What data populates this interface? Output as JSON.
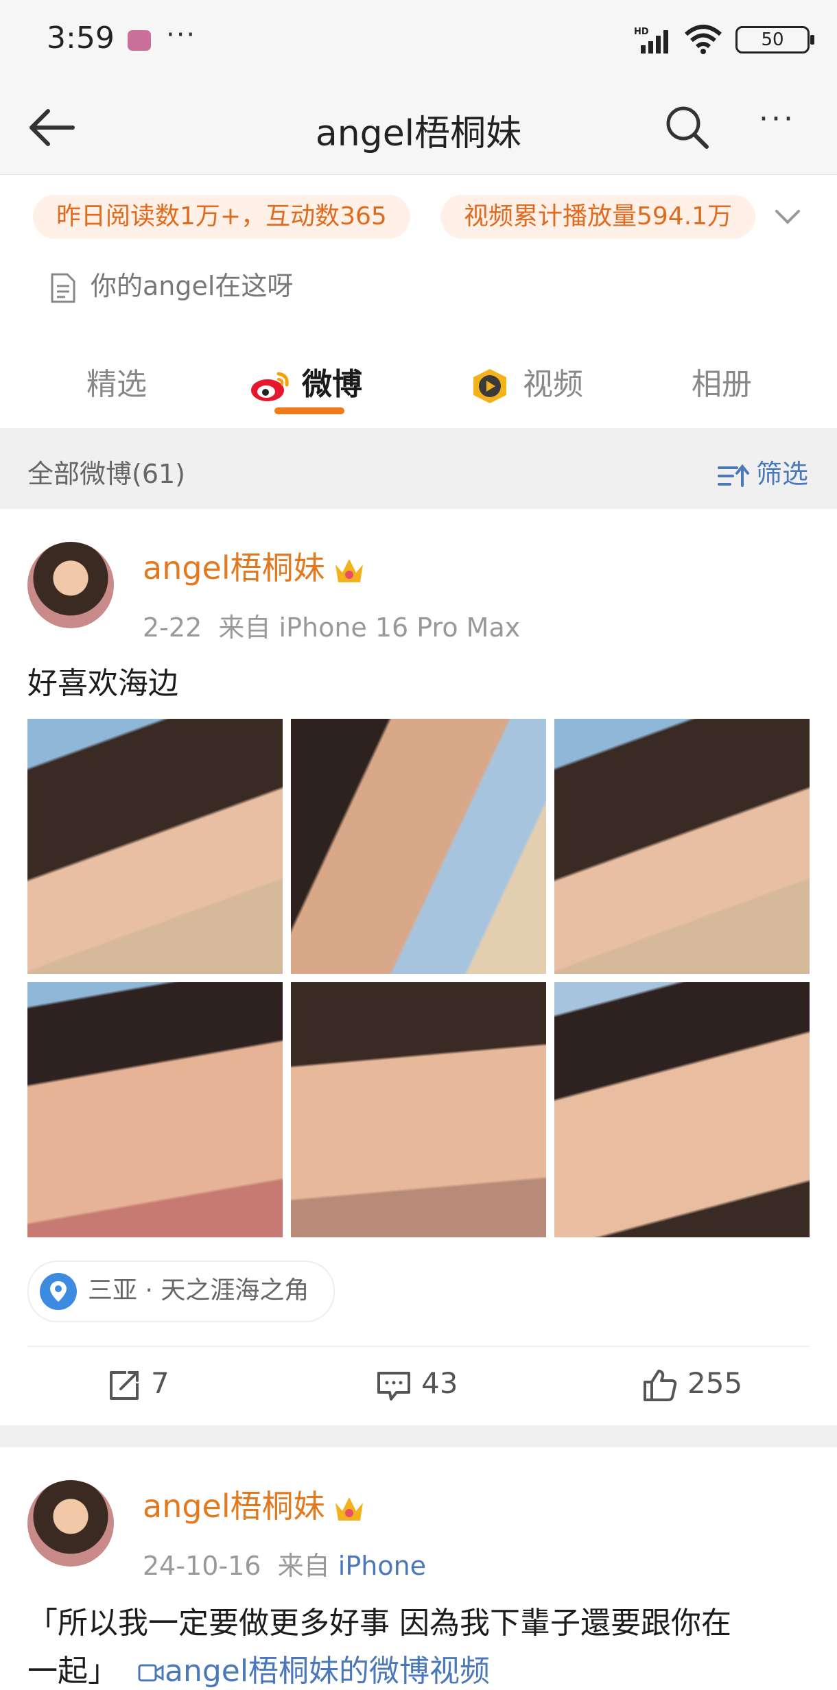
{
  "status_bar": {
    "time": "3:59",
    "dots": "···",
    "battery": "50"
  },
  "navbar": {
    "title": "angel梧桐妹",
    "more": "···"
  },
  "stats": {
    "pill1": "昨日阅读数1万+，互动数365",
    "pill2": "视频累计播放量594.1万",
    "notice": "你的angel在这呀"
  },
  "tabs": [
    {
      "label": "精选"
    },
    {
      "label": "微博"
    },
    {
      "label": "视频"
    },
    {
      "label": "相册"
    }
  ],
  "filter_bar": {
    "all_label": "全部微博(61)",
    "filter_label": "筛选"
  },
  "posts": [
    {
      "username": "angel梧桐妹",
      "date": "2-22",
      "source_prefix": "来自",
      "source": "iPhone 16 Pro Max",
      "text": "好喜欢海边",
      "location": "三亚 · 天之涯海之角",
      "reposts": "7",
      "comments": "43",
      "likes": "255"
    },
    {
      "username": "angel梧桐妹",
      "date": "24-10-16",
      "source_prefix": "来自",
      "source": "iPhone",
      "text_line1": "「所以我一定要做更多好事 因為我下輩子還要跟你在",
      "text_line2": "一起」",
      "video_link": "angel梧桐妹的微博视频"
    }
  ],
  "colors": {
    "accent": "#e4781e",
    "link": "#4a78b8",
    "pill_bg": "#fff1e8"
  }
}
